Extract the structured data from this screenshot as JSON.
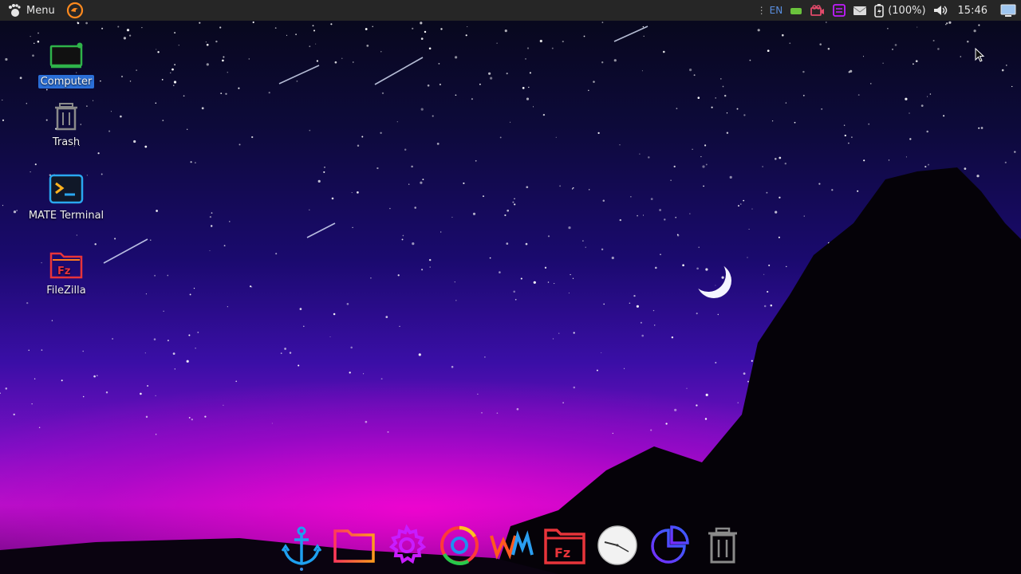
{
  "panel": {
    "menu_label": "Menu",
    "keyboard_layout": "EN",
    "battery_text": "(100%)",
    "clock": "15:46"
  },
  "desktop": {
    "icons": [
      {
        "label": "Computer",
        "icon": "computer-icon",
        "selected": true
      },
      {
        "label": "Trash",
        "icon": "trash-icon"
      },
      {
        "label": "MATE Terminal",
        "icon": "terminal-icon"
      },
      {
        "label": "FileZilla",
        "icon": "filezilla-icon"
      }
    ]
  },
  "dock": {
    "items": [
      "anchor-icon",
      "folder-icon",
      "settings-icon",
      "chrome-icon",
      "wm-icon",
      "filezilla-icon",
      "clock-icon",
      "pie-chart-icon",
      "trash-icon"
    ]
  },
  "colors": {
    "panel_bg": "#262626",
    "selection": "#2a6fd8",
    "accent_magenta": "#e21cff"
  }
}
